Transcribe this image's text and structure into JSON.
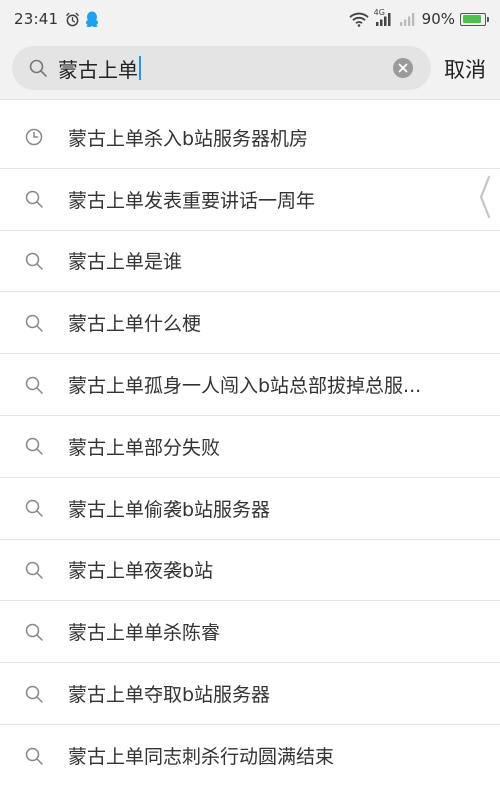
{
  "status_bar": {
    "time": "23:41",
    "network": "4G",
    "battery_percent": "90%",
    "battery_level": 0.9,
    "battery_color": "#4cc24c"
  },
  "search": {
    "query": "蒙古上单",
    "caret_color": "#1a9be6",
    "cancel_label": "取消"
  },
  "suggestions": [
    {
      "icon": "history-clock-icon",
      "label": "蒙古上单杀入b站服务器机房"
    },
    {
      "icon": "search-icon",
      "label": "蒙古上单发表重要讲话一周年"
    },
    {
      "icon": "search-icon",
      "label": "蒙古上单是谁"
    },
    {
      "icon": "search-icon",
      "label": "蒙古上单什么梗"
    },
    {
      "icon": "search-icon",
      "label": "蒙古上单孤身一人闯入b站总部拔掉总服..."
    },
    {
      "icon": "search-icon",
      "label": "蒙古上单部分失败"
    },
    {
      "icon": "search-icon",
      "label": "蒙古上单偷袭b站服务器"
    },
    {
      "icon": "search-icon",
      "label": "蒙古上单夜袭b站"
    },
    {
      "icon": "search-icon",
      "label": "蒙古上单单杀陈睿"
    },
    {
      "icon": "search-icon",
      "label": "蒙古上单夺取b站服务器"
    },
    {
      "icon": "search-icon",
      "label": "蒙古上单同志刺杀行动圆满结束"
    }
  ]
}
